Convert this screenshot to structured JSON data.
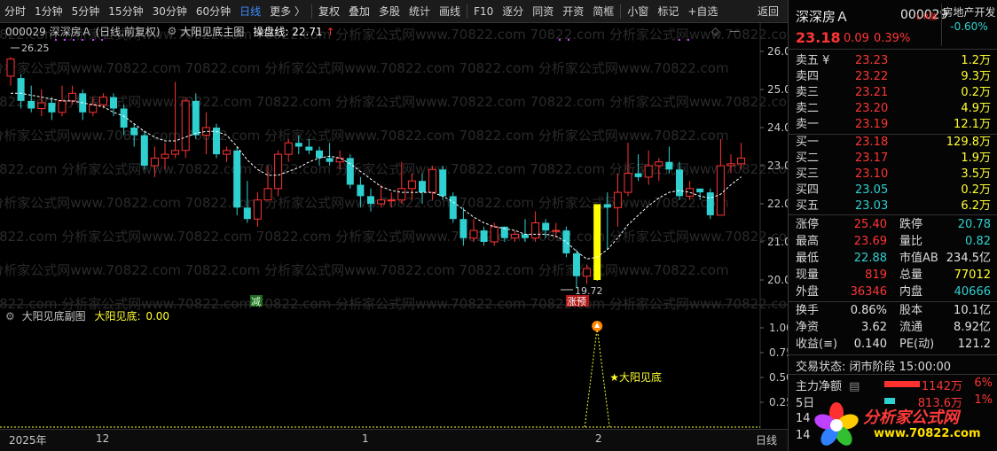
{
  "toolbar": {
    "items": [
      "分时",
      "1分钟",
      "5分钟",
      "15分钟",
      "30分钟",
      "60分钟",
      "日线",
      "更多 〉",
      "复权",
      "叠加",
      "多股",
      "统计",
      "画线",
      "F10",
      "逐分",
      "同资",
      "开资",
      "简框",
      "小窗",
      "标记",
      "+自选",
      "返回"
    ],
    "active": "日线"
  },
  "main_legend": {
    "stock": "000029 深深房Ａ (日线,前复权)",
    "indicator": "大阳见底主图",
    "ma_label": "操盘线:",
    "ma_value": "22.71",
    "arrow": "↑"
  },
  "main_annotations": {
    "high_label": "26.25",
    "low_label": "19.72",
    "reduce_tag": "减",
    "signal_tag": "涨预"
  },
  "sub_legend": {
    "indicator": "大阳见底副图",
    "series": "大阳见底:",
    "value": "0.00",
    "signal_text": "★大阳见底"
  },
  "main_yaxis": [
    "26.00",
    "25.00",
    "24.00",
    "23.00",
    "22.00",
    "21.00",
    "20.00"
  ],
  "sub_yaxis": [
    "1.00",
    "0.75",
    "0.50",
    "0.25"
  ],
  "date_axis": {
    "labels": [
      "2025年",
      "12",
      "1",
      "2"
    ],
    "period": "日线"
  },
  "watermark": "70822.com 分析家公式网www.70822.com",
  "chart_data": {
    "type": "candlestick",
    "colors": {
      "up": "#ff3333",
      "down": "#2fd0d0",
      "ma": "#ffffff",
      "signal_bar": "#ffff00"
    },
    "ylim": [
      19.6,
      26.35
    ],
    "candles": [
      [
        25.35,
        25.8,
        25.85,
        25.1
      ],
      [
        25.3,
        24.7,
        25.4,
        24.5
      ],
      [
        24.7,
        24.5,
        25.1,
        24.4
      ],
      [
        24.5,
        24.65,
        25.0,
        24.3
      ],
      [
        24.65,
        24.4,
        24.8,
        24.2
      ],
      [
        24.4,
        24.7,
        25.1,
        24.3
      ],
      [
        24.7,
        24.9,
        25.1,
        24.6
      ],
      [
        24.9,
        24.4,
        25.0,
        24.2
      ],
      [
        24.4,
        24.6,
        24.8,
        24.3
      ],
      [
        24.6,
        24.8,
        24.9,
        24.5
      ],
      [
        24.8,
        24.5,
        24.9,
        24.3
      ],
      [
        24.5,
        24.0,
        24.6,
        23.8
      ],
      [
        24.0,
        23.8,
        24.1,
        23.5
      ],
      [
        23.8,
        23.0,
        23.9,
        22.9
      ],
      [
        23.0,
        23.2,
        23.5,
        22.7
      ],
      [
        23.2,
        23.3,
        23.6,
        22.9
      ],
      [
        23.3,
        23.4,
        25.2,
        23.2
      ],
      [
        23.4,
        24.7,
        24.8,
        23.2
      ],
      [
        24.7,
        23.8,
        24.9,
        23.7
      ],
      [
        23.8,
        24.0,
        24.4,
        23.3
      ],
      [
        24.0,
        23.3,
        24.1,
        23.2
      ],
      [
        23.3,
        23.4,
        23.5,
        23.1
      ],
      [
        23.4,
        21.9,
        23.5,
        21.7
      ],
      [
        21.9,
        21.6,
        22.6,
        21.5
      ],
      [
        21.6,
        22.1,
        22.3,
        21.4
      ],
      [
        22.1,
        22.4,
        23.0,
        22.3
      ],
      [
        22.4,
        23.3,
        23.4,
        22.2
      ],
      [
        23.3,
        23.6,
        23.7,
        23.1
      ],
      [
        23.6,
        23.5,
        23.8,
        23.3
      ],
      [
        23.5,
        23.4,
        23.7,
        23.3
      ],
      [
        23.4,
        23.2,
        23.5,
        23.0
      ],
      [
        23.2,
        23.1,
        23.6,
        23.0
      ],
      [
        23.1,
        23.2,
        23.4,
        22.9
      ],
      [
        23.2,
        22.5,
        23.3,
        22.4
      ],
      [
        22.5,
        22.2,
        22.7,
        21.9
      ],
      [
        22.2,
        22.0,
        22.4,
        21.8
      ],
      [
        22.0,
        22.1,
        22.5,
        21.9
      ],
      [
        22.1,
        22.1,
        22.3,
        21.9
      ],
      [
        22.1,
        22.4,
        23.1,
        22.0
      ],
      [
        22.4,
        22.6,
        22.8,
        22.1
      ],
      [
        22.6,
        22.3,
        22.8,
        22.0
      ],
      [
        22.3,
        22.9,
        23.0,
        22.1
      ],
      [
        22.9,
        22.2,
        23.0,
        22.1
      ],
      [
        22.2,
        21.6,
        22.3,
        21.5
      ],
      [
        21.6,
        21.1,
        21.9,
        20.9
      ],
      [
        21.1,
        21.3,
        21.6,
        21.0
      ],
      [
        21.3,
        21.0,
        21.4,
        20.9
      ],
      [
        21.0,
        21.4,
        21.5,
        20.9
      ],
      [
        21.4,
        21.1,
        21.4,
        21.0
      ],
      [
        21.1,
        21.2,
        21.3,
        21.0
      ],
      [
        21.2,
        21.1,
        21.6,
        21.0
      ],
      [
        21.1,
        21.5,
        21.8,
        21.0
      ],
      [
        21.5,
        21.3,
        21.6,
        21.1
      ],
      [
        21.3,
        21.3,
        21.5,
        21.1
      ],
      [
        21.3,
        20.7,
        21.4,
        20.6
      ],
      [
        20.7,
        20.1,
        20.8,
        19.8
      ],
      [
        20.1,
        20.3,
        20.4,
        19.9
      ],
      [
        20.0,
        21.99,
        21.99,
        19.98
      ],
      [
        21.99,
        21.9,
        22.3,
        20.8
      ],
      [
        21.9,
        22.3,
        22.8,
        21.4
      ],
      [
        22.3,
        22.8,
        23.6,
        22.2
      ],
      [
        22.8,
        22.7,
        23.3,
        22.6
      ],
      [
        22.7,
        23.0,
        23.4,
        22.5
      ],
      [
        23.0,
        23.1,
        23.2,
        22.6
      ],
      [
        23.1,
        22.9,
        23.5,
        22.8
      ],
      [
        22.9,
        22.2,
        23.1,
        22.1
      ],
      [
        22.2,
        22.4,
        22.6,
        22.1
      ],
      [
        22.4,
        22.3,
        22.4,
        22.1
      ],
      [
        22.3,
        21.7,
        22.4,
        21.6
      ],
      [
        21.7,
        23.0,
        23.7,
        21.7
      ],
      [
        23.0,
        23.05,
        23.3,
        22.8
      ],
      [
        23.05,
        23.2,
        23.6,
        22.9
      ]
    ],
    "ma": [
      24.9,
      24.9,
      24.85,
      24.8,
      24.75,
      24.7,
      24.7,
      24.65,
      24.6,
      24.55,
      24.4,
      24.3,
      24.1,
      23.9,
      23.75,
      23.65,
      23.65,
      23.75,
      23.85,
      23.9,
      23.9,
      23.8,
      23.5,
      23.15,
      22.9,
      22.75,
      22.75,
      22.85,
      22.95,
      23.1,
      23.2,
      23.25,
      23.2,
      23.05,
      22.85,
      22.65,
      22.45,
      22.35,
      22.3,
      22.3,
      22.3,
      22.3,
      22.2,
      22.05,
      21.85,
      21.65,
      21.5,
      21.4,
      21.35,
      21.3,
      21.2,
      21.2,
      21.2,
      21.15,
      21.0,
      20.75,
      20.55,
      20.6,
      20.8,
      21.1,
      21.45,
      21.7,
      21.95,
      22.15,
      22.3,
      22.35,
      22.3,
      22.2,
      22.15,
      22.25,
      22.5,
      22.71
    ],
    "sub_series": {
      "name": "大阳见底",
      "signal_index": 57,
      "ylim": [
        0,
        1.1
      ]
    }
  },
  "panel": {
    "name": "深深房Ａ",
    "code": "000029",
    "flags": "L R融",
    "price": "23.18",
    "change": "0.09",
    "pct": "0.39%",
    "sector": "房地产开发",
    "sector_pct": "-0.60%",
    "asks": [
      {
        "label": "卖五 ¥",
        "price": "23.23",
        "vol": "1.2万"
      },
      {
        "label": "卖四",
        "price": "23.22",
        "vol": "9.3万"
      },
      {
        "label": "卖三",
        "price": "23.21",
        "vol": "0.2万"
      },
      {
        "label": "卖二",
        "price": "23.20",
        "vol": "4.9万"
      },
      {
        "label": "卖一",
        "price": "23.19",
        "vol": "12.1万"
      }
    ],
    "bids": [
      {
        "label": "买一",
        "price": "23.18",
        "vol": "129.8万"
      },
      {
        "label": "买二",
        "price": "23.17",
        "vol": "1.9万"
      },
      {
        "label": "买三",
        "price": "23.10",
        "vol": "3.5万"
      },
      {
        "label": "买四",
        "price": "23.05",
        "vol": "0.2万"
      },
      {
        "label": "买五",
        "price": "23.03",
        "vol": "6.2万"
      }
    ],
    "stats1": [
      {
        "l1": "涨停",
        "v1": "25.40",
        "c1": "red",
        "l2": "跌停",
        "v2": "20.78",
        "c2": "cyan"
      },
      {
        "l1": "最高",
        "v1": "23.69",
        "c1": "red",
        "l2": "量比",
        "v2": "0.82",
        "c2": "cyan"
      },
      {
        "l1": "最低",
        "v1": "22.88",
        "c1": "cyan",
        "l2": "市值AB",
        "v2": "234.5亿",
        "c2": "white"
      },
      {
        "l1": "现量",
        "v1": "819",
        "c1": "red",
        "l2": "总量",
        "v2": "77012",
        "c2": "yellow"
      },
      {
        "l1": "外盘",
        "v1": "36346",
        "c1": "red",
        "l2": "内盘",
        "v2": "40666",
        "c2": "cyan"
      }
    ],
    "stats2": [
      {
        "l1": "换手",
        "v1": "0.86%",
        "c1": "white",
        "l2": "股本",
        "v2": "10.1亿",
        "c2": "white"
      },
      {
        "l1": "净资",
        "v1": "3.62",
        "c1": "white",
        "l2": "流通",
        "v2": "8.92亿",
        "c2": "white"
      },
      {
        "l1": "收益(≡)",
        "v1": "0.140",
        "c1": "white",
        "l2": "PE(动)",
        "v2": "121.2",
        "c2": "white"
      }
    ],
    "trade_state": "交易状态: 闭市阶段 15:00:00",
    "flow1": {
      "label": "主力净额",
      "value": "1142万",
      "pct": "6%"
    },
    "flow2": {
      "label": "5日",
      "value": "813.6万",
      "pct": "1%"
    },
    "row14a": "14",
    "row14b": "14"
  },
  "logo": {
    "title": "分析家公式网",
    "url": "www.70822.com"
  }
}
